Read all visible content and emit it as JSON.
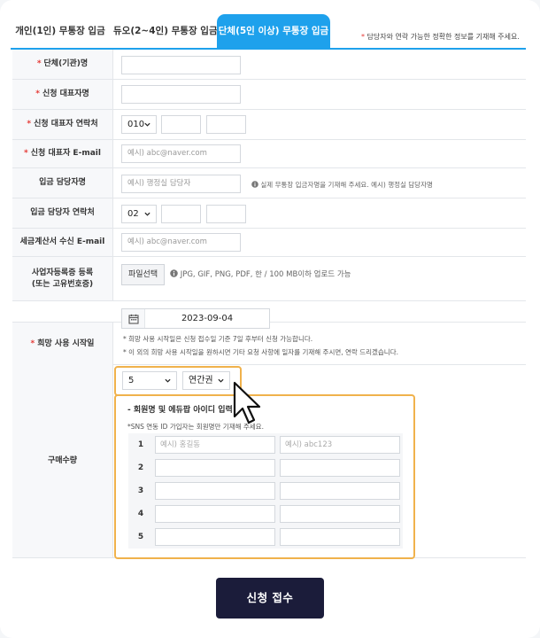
{
  "tabs": [
    {
      "label": "개인(1인) 무통장 입금",
      "active": false
    },
    {
      "label": "듀오(2~4인) 무통장 입금",
      "active": false
    },
    {
      "label": "단체(5인 이상) 무통장 입금",
      "active": true
    }
  ],
  "tab_note_star": "*",
  "tab_note": "담당자와 연락 가능한 정확한 정보를 기재해 주세요.",
  "form": {
    "org_name": {
      "label": "단체(기관)명",
      "required": "*"
    },
    "rep_name": {
      "label": "신청 대표자명",
      "required": "*"
    },
    "rep_phone": {
      "label": "신청 대표자 연락처",
      "required": "*",
      "prefix": "010"
    },
    "rep_email": {
      "label": "신청 대표자 E-mail",
      "required": "*",
      "placeholder": "예시) abc@naver.com"
    },
    "deposit_name": {
      "label": "입금 담당자명",
      "placeholder": "예시) 행정실 담당자",
      "hint": "실제 무통장 입금자명을 기재해 주세요. 예시) 행정실 담당자명"
    },
    "deposit_phone": {
      "label": "입금 담당자 연락처",
      "prefix": "02"
    },
    "tax_email": {
      "label": "세금계산서 수신 E-mail",
      "placeholder": "예시) abc@naver.com"
    },
    "biz_reg": {
      "label_line1": "사업자등록증 등록",
      "label_line2": "(또는 고유번호증)",
      "button": "파일선택",
      "hint": "JPG, GIF, PNG, PDF, 한 / 100 MB이하 업로드 가능"
    },
    "start_date": {
      "label": "희망 사용 시작일",
      "required": "*",
      "value": "2023-09-04",
      "note1": "* 희망 사용 시작일은 신청 접수일 기준 7일 후부터 신청 가능합니다.",
      "note2": "* 이 외의 희망 사용 시작일을 원하시면 기타 요청 사항에 일자를 기재해 주시면, 연락 드리겠습니다."
    },
    "quantity": {
      "label": "구매수량",
      "count": "5",
      "plan": "연간권"
    }
  },
  "members": {
    "title": "- 회원명 및 에듀팝 아이디 입력",
    "note": "*SNS 연동 ID 가입자는 회원명만 기재해 주세요.",
    "rows": [
      {
        "num": "1",
        "name_placeholder": "예시) 홍길동",
        "id_placeholder": "예시) abc123"
      },
      {
        "num": "2",
        "name_placeholder": "",
        "id_placeholder": ""
      },
      {
        "num": "3",
        "name_placeholder": "",
        "id_placeholder": ""
      },
      {
        "num": "4",
        "name_placeholder": "",
        "id_placeholder": ""
      },
      {
        "num": "5",
        "name_placeholder": "",
        "id_placeholder": ""
      }
    ]
  },
  "submit_label": "신청 접수",
  "colors": {
    "accent": "#1ea1ec",
    "highlight": "#f0b24c",
    "submit": "#1b1c3a",
    "required": "#e53935"
  }
}
